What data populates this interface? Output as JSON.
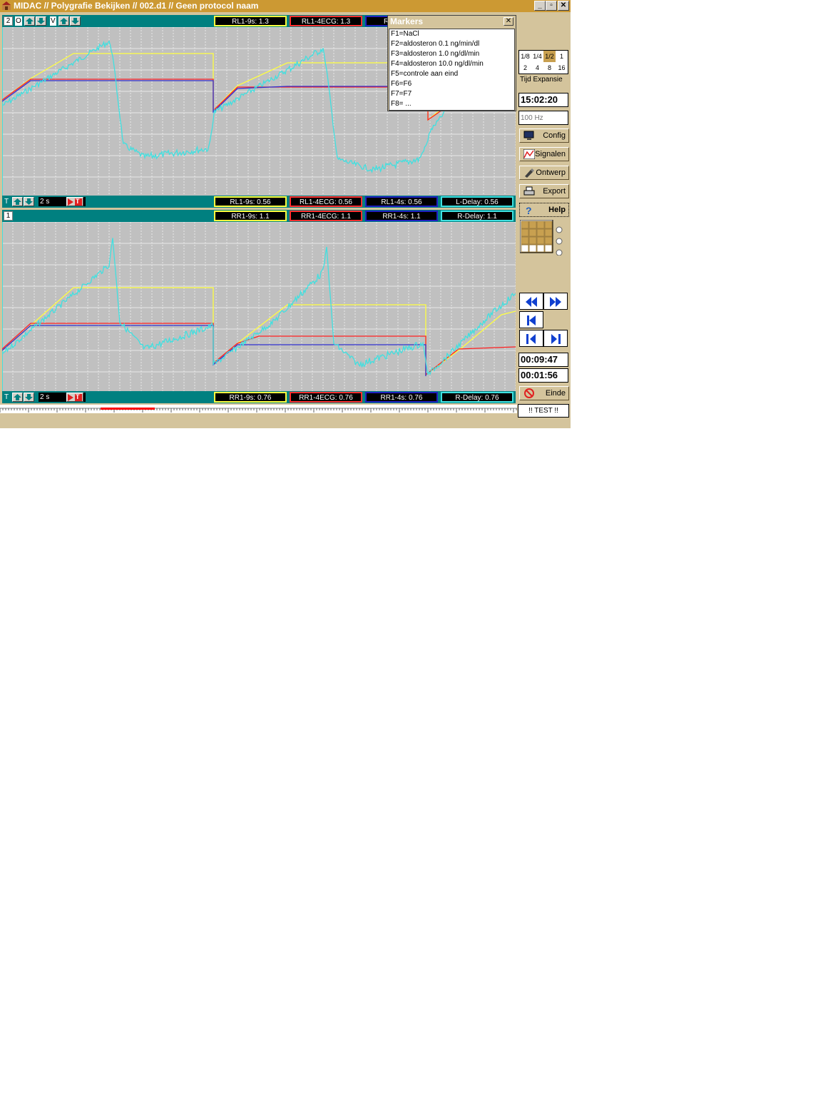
{
  "window": {
    "title": "MIDAC // Polygrafie Bekijken // 002.d1 // Geen protocol naam",
    "btn_min": "_",
    "btn_restore": "▫",
    "btn_close": "✕"
  },
  "panel_top": {
    "channel_number": "2",
    "o_label": "O",
    "v_label": "V",
    "top_measurements": [
      "RL1-9s: 1.3",
      "RL1-4ECG: 1.3"
    ],
    "t_label": "T",
    "time_scale": "2 s",
    "trigger_label": "T",
    "bottom_measurements": [
      "RL1-9s: 0.56",
      "RL1-4ECG: 0.56",
      "RL1-4s: 0.56",
      "L-Delay: 0.56"
    ]
  },
  "panel_bottom": {
    "channel_number": "1",
    "top_measurements": [
      "RR1-9s: 1.1",
      "RR1-4ECG: 1.1",
      "RR1-4s: 1.1",
      "R-Delay: 1.1"
    ],
    "t_label": "T",
    "time_scale": "2 s",
    "trigger_label": "T",
    "bottom_measurements": [
      "RR1-9s: 0.76",
      "RR1-4ECG: 0.76",
      "RR1-4s: 0.76",
      "R-Delay: 0.76"
    ]
  },
  "markers": {
    "title": "Markers",
    "close": "✕",
    "items": [
      "F1=NaCl",
      "F2=aldosteron 0.1 ng/min/dl",
      "F3=aldosteron 1.0 ng/dl/min",
      "F4=aldosteron 10.0 ng/dl/min",
      "F5=controle aan eind",
      "F6=F6",
      "F7=F7",
      "F8= ..."
    ],
    "hidden_partial": "R"
  },
  "sidebar": {
    "expansion_values": [
      "1/8",
      "1/4",
      "1/2",
      "1",
      "2",
      "4",
      "8",
      "16"
    ],
    "expansion_selected": "1/2",
    "expansion_label": "Tijd Expansie",
    "clock": "15:02:20",
    "sample_rate_placeholder": "100 Hz",
    "buttons": {
      "config": "Config",
      "signalen": "Signalen",
      "ontwerp": "Ontwerp",
      "export": "Export",
      "help": "Help",
      "einde": "Einde"
    },
    "time_position": "00:09:47",
    "time_window": "00:01:56",
    "test": "!! TEST !!"
  },
  "colors": {
    "teal_strip": "#008080",
    "plot_bg": "#c0c0c0",
    "trace_cyan": "#40e0e0",
    "trace_yellow": "#ffff40",
    "trace_red": "#ff2020",
    "trace_blue": "#2020c0",
    "title_bar": "#cc9933",
    "chassis": "#d4c49c"
  },
  "icons": [
    "app-icon",
    "arrow-up-icon",
    "arrow-down-icon",
    "trigger-icon",
    "monitor-icon",
    "signals-icon",
    "design-icon",
    "printer-icon",
    "help-icon",
    "stop-icon",
    "rewind-icon",
    "forward-icon",
    "go-start-icon",
    "step-back-icon",
    "step-forward-icon"
  ]
}
